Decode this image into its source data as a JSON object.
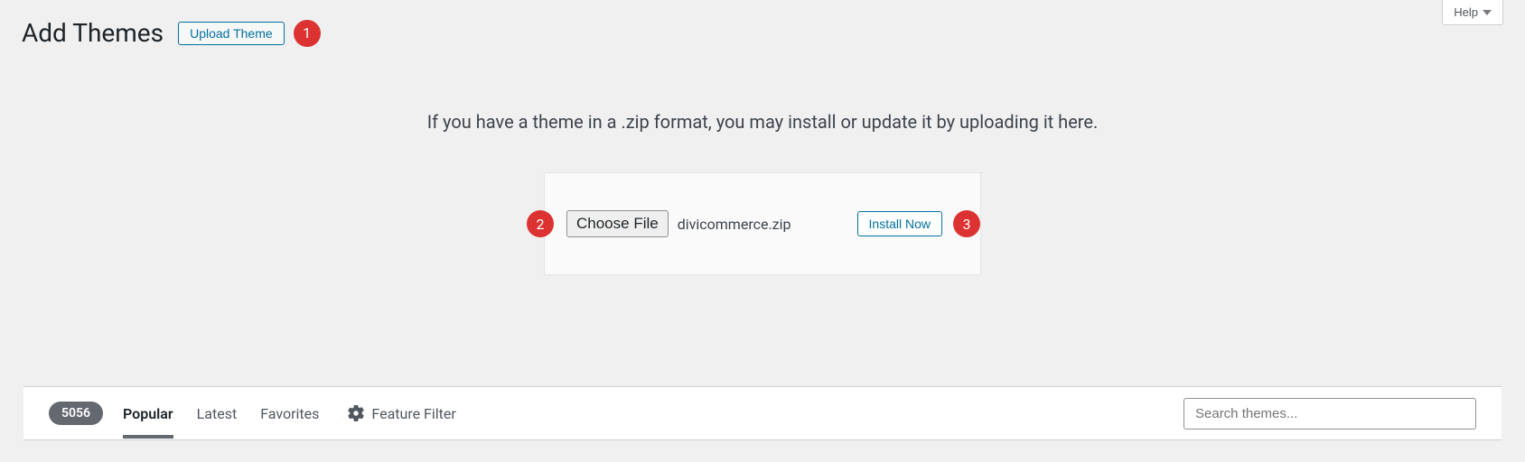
{
  "help_button": "Help",
  "header": {
    "page_title": "Add Themes",
    "upload_button": "Upload Theme"
  },
  "annotations": {
    "badge_1": "1",
    "badge_2": "2",
    "badge_3": "3"
  },
  "upload_panel": {
    "message": "If you have a theme in a .zip format, you may install or update it by uploading it here.",
    "choose_file_label": "Choose File",
    "file_name": "divicommerce.zip",
    "install_button": "Install Now"
  },
  "filter_bar": {
    "theme_count": "5056",
    "tabs": {
      "popular": "Popular",
      "latest": "Latest",
      "favorites": "Favorites"
    },
    "feature_filter": "Feature Filter",
    "search_placeholder": "Search themes..."
  }
}
